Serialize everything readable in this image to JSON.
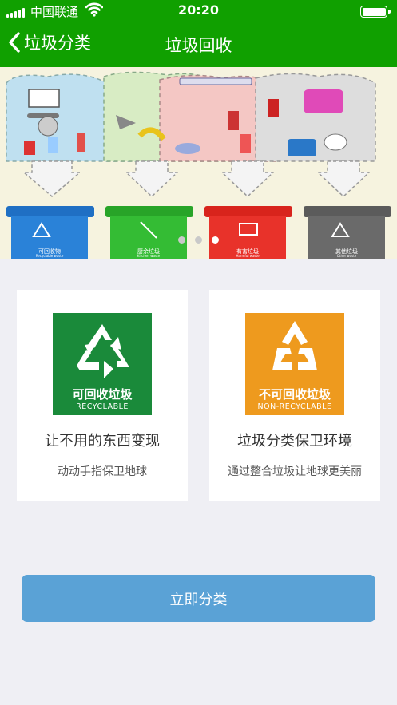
{
  "status_bar": {
    "carrier": "中国联通",
    "time": "20:20",
    "signal_icon": "signal-bars-icon",
    "wifi_icon": "wifi-icon",
    "battery_icon": "battery-full-icon",
    "battery_level": 1.0
  },
  "nav": {
    "back_label": "垃圾分类",
    "back_icon": "chevron-left-icon",
    "title": "垃圾回收"
  },
  "banner": {
    "bins": [
      {
        "label": "可回收物",
        "en": "Recyclable waste",
        "color": "#1f6fc4"
      },
      {
        "label": "厨余垃圾",
        "en": "Kitchen waste",
        "color": "#28a428"
      },
      {
        "label": "有害垃圾",
        "en": "Harmful waste",
        "color": "#d8241c"
      },
      {
        "label": "其他垃圾",
        "en": "Other waste",
        "color": "#5b5b5b"
      }
    ],
    "dot_count": 3,
    "active_dot": 2
  },
  "cards": [
    {
      "logo_name": "可回收垃圾",
      "logo_en": "RECYCLABLE",
      "logo_color": "#1a8a3a",
      "logo_icon": "recycle-icon",
      "headline": "让不用的东西变现",
      "sub": "动动手指保卫地球"
    },
    {
      "logo_name": "不可回收垃圾",
      "logo_en": "NON-RECYCLABLE",
      "logo_color": "#ee9a1e",
      "logo_icon": "non-recyclable-icon",
      "headline": "垃圾分类保卫环境",
      "sub": "通过整合垃圾让地球更美丽"
    }
  ],
  "action_button": {
    "label": "立即分类",
    "color": "#5aa2d6"
  }
}
